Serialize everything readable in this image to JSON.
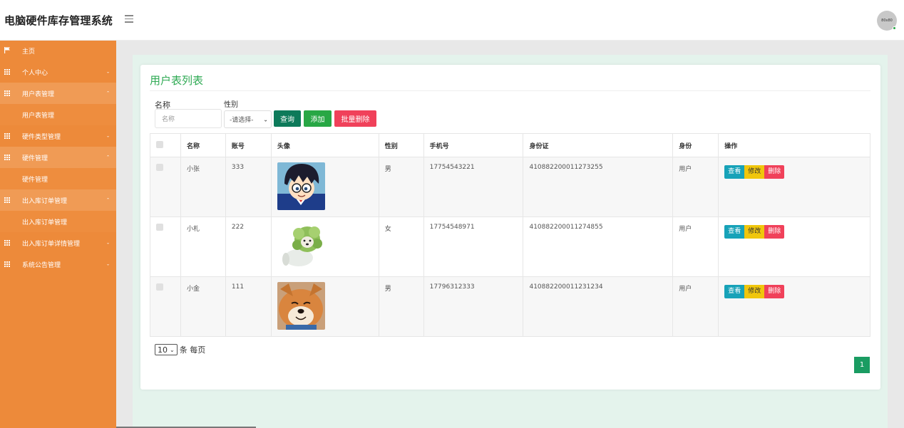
{
  "app": {
    "title": "电脑硬件库存管理系统",
    "avatar_text": "80x80"
  },
  "sidebar": {
    "items": [
      {
        "label": "主页",
        "arrow": ""
      },
      {
        "label": "个人中心",
        "arrow": "⌄"
      },
      {
        "label": "用户表管理",
        "arrow": "⌃"
      },
      {
        "label": "用户表管理",
        "arrow": ""
      },
      {
        "label": "硬件类型管理",
        "arrow": "⌄"
      },
      {
        "label": "硬件管理",
        "arrow": "⌃"
      },
      {
        "label": "硬件管理",
        "arrow": ""
      },
      {
        "label": "出入库订单管理",
        "arrow": "⌃"
      },
      {
        "label": "出入库订单管理",
        "arrow": ""
      },
      {
        "label": "出入库订单详情管理",
        "arrow": "⌄"
      },
      {
        "label": "系统公告管理",
        "arrow": "⌄"
      }
    ]
  },
  "panel": {
    "title": "用户表列表"
  },
  "filters": {
    "name_label": "名称",
    "name_placeholder": "名称",
    "gender_label": "性别",
    "gender_selected": "-请选择-",
    "query_label": "查询",
    "add_label": "添加",
    "batch_delete_label": "批量删除"
  },
  "table": {
    "headers": [
      "名称",
      "账号",
      "头像",
      "性别",
      "手机号",
      "身份证",
      "身份",
      "操作"
    ],
    "rows": [
      {
        "name": "小张",
        "account": "333",
        "avatar": "detective-cartoon-avatar",
        "gender": "男",
        "phone": "17754543221",
        "idcard": "410882200011273255",
        "role": "用户"
      },
      {
        "name": "小札",
        "account": "222",
        "avatar": "lettuce-dog-avatar",
        "gender": "女",
        "phone": "17754548971",
        "idcard": "410882200011274855",
        "role": "用户"
      },
      {
        "name": "小金",
        "account": "111",
        "avatar": "shiba-dog-avatar",
        "gender": "男",
        "phone": "17796312333",
        "idcard": "410882200011231234",
        "role": "用户"
      }
    ],
    "ops": {
      "view": "查看",
      "edit": "修改",
      "delete": "删除"
    }
  },
  "pager": {
    "page_size": "10",
    "per_page_label": "条 每页",
    "current_page": "1"
  },
  "colors": {
    "sidebar": "#ed8a3a",
    "accent_green": "#2faa54",
    "query_button": "#0d7a5a",
    "add_button": "#28a745",
    "delete_button": "#f0415a",
    "view_button": "#17a2b8",
    "edit_button": "#f0c60c",
    "page_active": "#1a9c62"
  }
}
